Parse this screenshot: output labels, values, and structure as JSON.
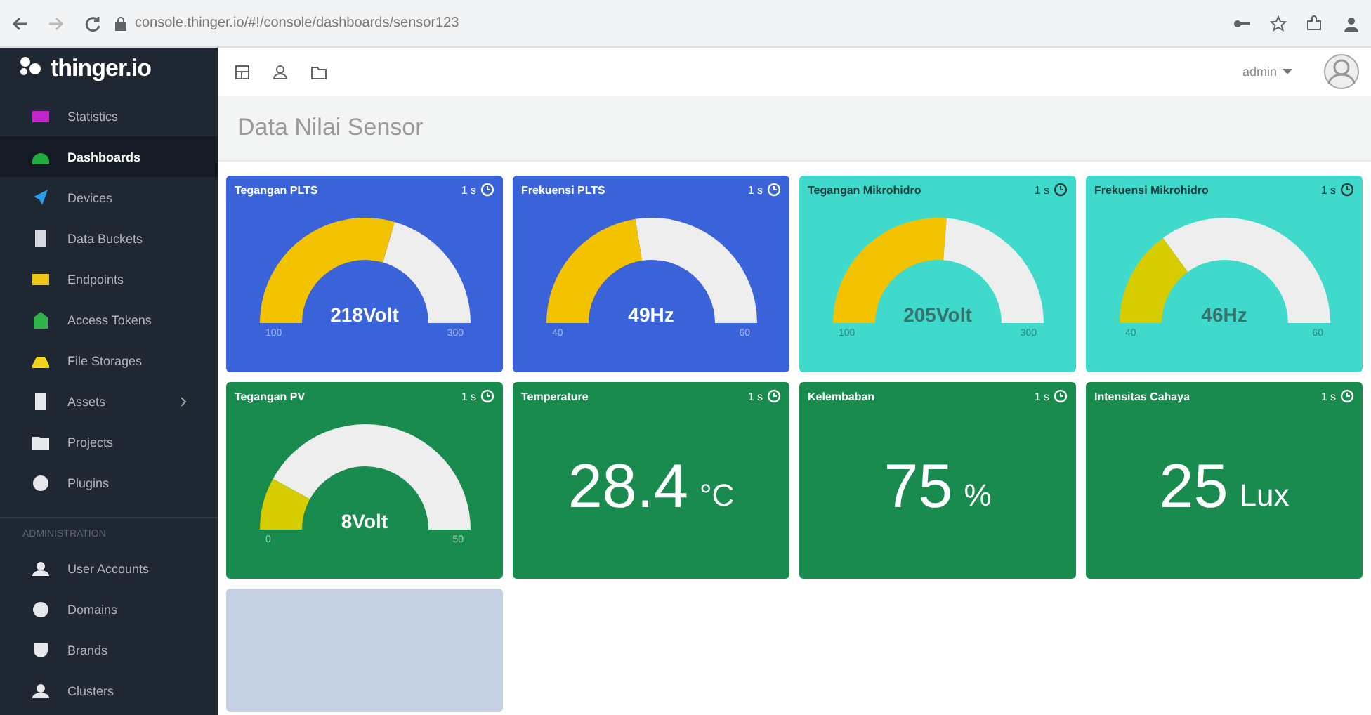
{
  "browser": {
    "url": "console.thinger.io/#!/console/dashboards/sensor123"
  },
  "sidebar": {
    "logo": "thinger.io",
    "items": [
      {
        "label": "Statistics",
        "color": "#c026c9",
        "selected": false
      },
      {
        "label": "Dashboards",
        "color": "#1faa3c",
        "selected": true
      },
      {
        "label": "Devices",
        "color": "#2a9ee8",
        "selected": false
      },
      {
        "label": "Data Buckets",
        "color": "#d5d8dc",
        "selected": false
      },
      {
        "label": "Endpoints",
        "color": "#f0c419",
        "selected": false
      },
      {
        "label": "Access Tokens",
        "color": "#2fb34a",
        "selected": false
      },
      {
        "label": "File Storages",
        "color": "#f0d419",
        "selected": false
      },
      {
        "label": "Assets",
        "color": "#e6e8ea",
        "selected": false,
        "has_children": true
      },
      {
        "label": "Projects",
        "color": "#e6e8ea",
        "selected": false
      },
      {
        "label": "Plugins",
        "color": "#e6e8ea",
        "selected": false
      }
    ],
    "section": "ADMINISTRATION",
    "admin_items": [
      {
        "label": "User Accounts",
        "color": "#e6e8ea",
        "selected": false
      },
      {
        "label": "Domains",
        "color": "#e6e8ea",
        "selected": false
      },
      {
        "label": "Brands",
        "color": "#e6e8ea",
        "selected": false
      },
      {
        "label": "Clusters",
        "color": "#e6e8ea",
        "selected": false
      }
    ]
  },
  "topbar": {
    "user": "admin"
  },
  "dashboard": {
    "title": "Data Nilai Sensor",
    "cards": [
      {
        "kind": "gauge",
        "title": "Tegangan PLTS",
        "interval": "1 s",
        "color": "#3a62d9",
        "value": "218Volt",
        "min": "100",
        "max": "300"
      },
      {
        "kind": "gauge",
        "title": "Frekuensi PLTS",
        "interval": "1 s",
        "color": "#3a62d9",
        "value": "49Hz",
        "min": "40",
        "max": "60"
      },
      {
        "kind": "gauge",
        "title": "Tegangan Mikrohidro",
        "interval": "1 s",
        "color": "#3fdacb",
        "value": "205Volt",
        "min": "100",
        "max": "300"
      },
      {
        "kind": "gauge",
        "title": "Frekuensi Mikrohidro",
        "interval": "1 s",
        "color": "#3fdacb",
        "value": "46Hz",
        "min": "40",
        "max": "60"
      },
      {
        "kind": "gauge",
        "title": "Tegangan PV",
        "interval": "1 s",
        "color": "#1a8b4f",
        "value": "8Volt",
        "min": "0",
        "max": "50"
      },
      {
        "kind": "number",
        "title": "Temperature",
        "interval": "1 s",
        "color": "#1a8b4f",
        "value": "28.4",
        "unit": "°C"
      },
      {
        "kind": "number",
        "title": "Kelembaban",
        "interval": "1 s",
        "color": "#1a8b4f",
        "value": "75",
        "unit": "%"
      },
      {
        "kind": "number",
        "title": "Intensitas Cahaya",
        "interval": "1 s",
        "color": "#1a8b4f",
        "value": "25",
        "unit": "Lux"
      },
      {
        "kind": "empty",
        "color": "#c6d0e3"
      }
    ]
  }
}
